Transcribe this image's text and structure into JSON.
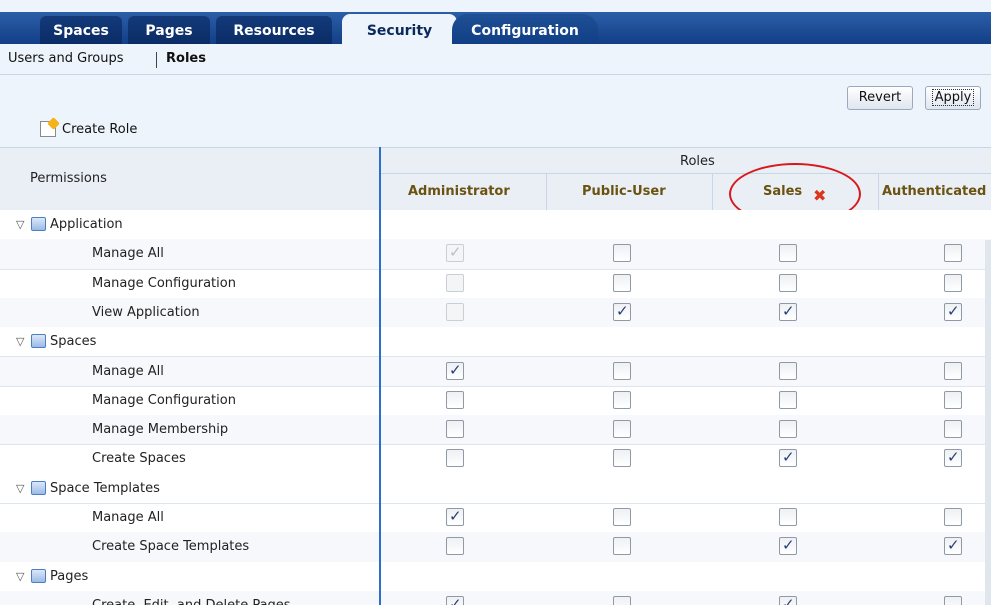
{
  "tabs": [
    {
      "label": "Spaces",
      "active": false
    },
    {
      "label": "Pages",
      "active": false
    },
    {
      "label": "Resources",
      "active": false
    },
    {
      "label": "Security",
      "active": true
    },
    {
      "label": "Configuration",
      "active": false
    }
  ],
  "subnav": {
    "users_groups": "Users and Groups",
    "roles": "Roles"
  },
  "toolbar": {
    "revert": "Revert",
    "apply": "Apply",
    "create_role": "Create Role"
  },
  "table": {
    "permissions_header": "Permissions",
    "roles_header": "Roles",
    "roles": [
      "Administrator",
      "Public-User",
      "Sales",
      "Authenticated"
    ],
    "rows": [
      {
        "type": "group",
        "label": "Application",
        "icon": "application-icon"
      },
      {
        "type": "perm",
        "label": "Manage All",
        "values": [
          "checked-disabled",
          "unchecked",
          "unchecked",
          "unchecked"
        ]
      },
      {
        "type": "perm",
        "label": "Manage Configuration",
        "values": [
          "unchecked-disabled",
          "unchecked",
          "unchecked",
          "unchecked"
        ]
      },
      {
        "type": "perm",
        "label": "View Application",
        "values": [
          "unchecked-disabled",
          "checked",
          "checked",
          "checked"
        ]
      },
      {
        "type": "group",
        "label": "Spaces",
        "icon": "spaces-icon"
      },
      {
        "type": "perm",
        "label": "Manage All",
        "values": [
          "checked",
          "unchecked",
          "unchecked",
          "unchecked"
        ]
      },
      {
        "type": "perm",
        "label": "Manage Configuration",
        "values": [
          "unchecked",
          "unchecked",
          "unchecked",
          "unchecked"
        ]
      },
      {
        "type": "perm",
        "label": "Manage Membership",
        "values": [
          "unchecked",
          "unchecked",
          "unchecked",
          "unchecked"
        ]
      },
      {
        "type": "perm",
        "label": "Create Spaces",
        "values": [
          "unchecked",
          "unchecked",
          "checked",
          "checked"
        ]
      },
      {
        "type": "group",
        "label": "Space Templates",
        "icon": "space-templates-icon"
      },
      {
        "type": "perm",
        "label": "Manage All",
        "values": [
          "checked",
          "unchecked",
          "unchecked",
          "unchecked"
        ]
      },
      {
        "type": "perm",
        "label": "Create Space Templates",
        "values": [
          "unchecked",
          "unchecked",
          "checked",
          "checked"
        ]
      },
      {
        "type": "group",
        "label": "Pages",
        "icon": "pages-icon"
      },
      {
        "type": "perm",
        "label": "Create, Edit, and Delete Pages",
        "values": [
          "checked",
          "unchecked",
          "checked",
          "unchecked"
        ]
      }
    ]
  },
  "colors": {
    "accent": "#2a6fd0",
    "highlight_oval": "#d8191b",
    "role_header_text": "#6a5210",
    "delete_icon": "#d9371b"
  }
}
